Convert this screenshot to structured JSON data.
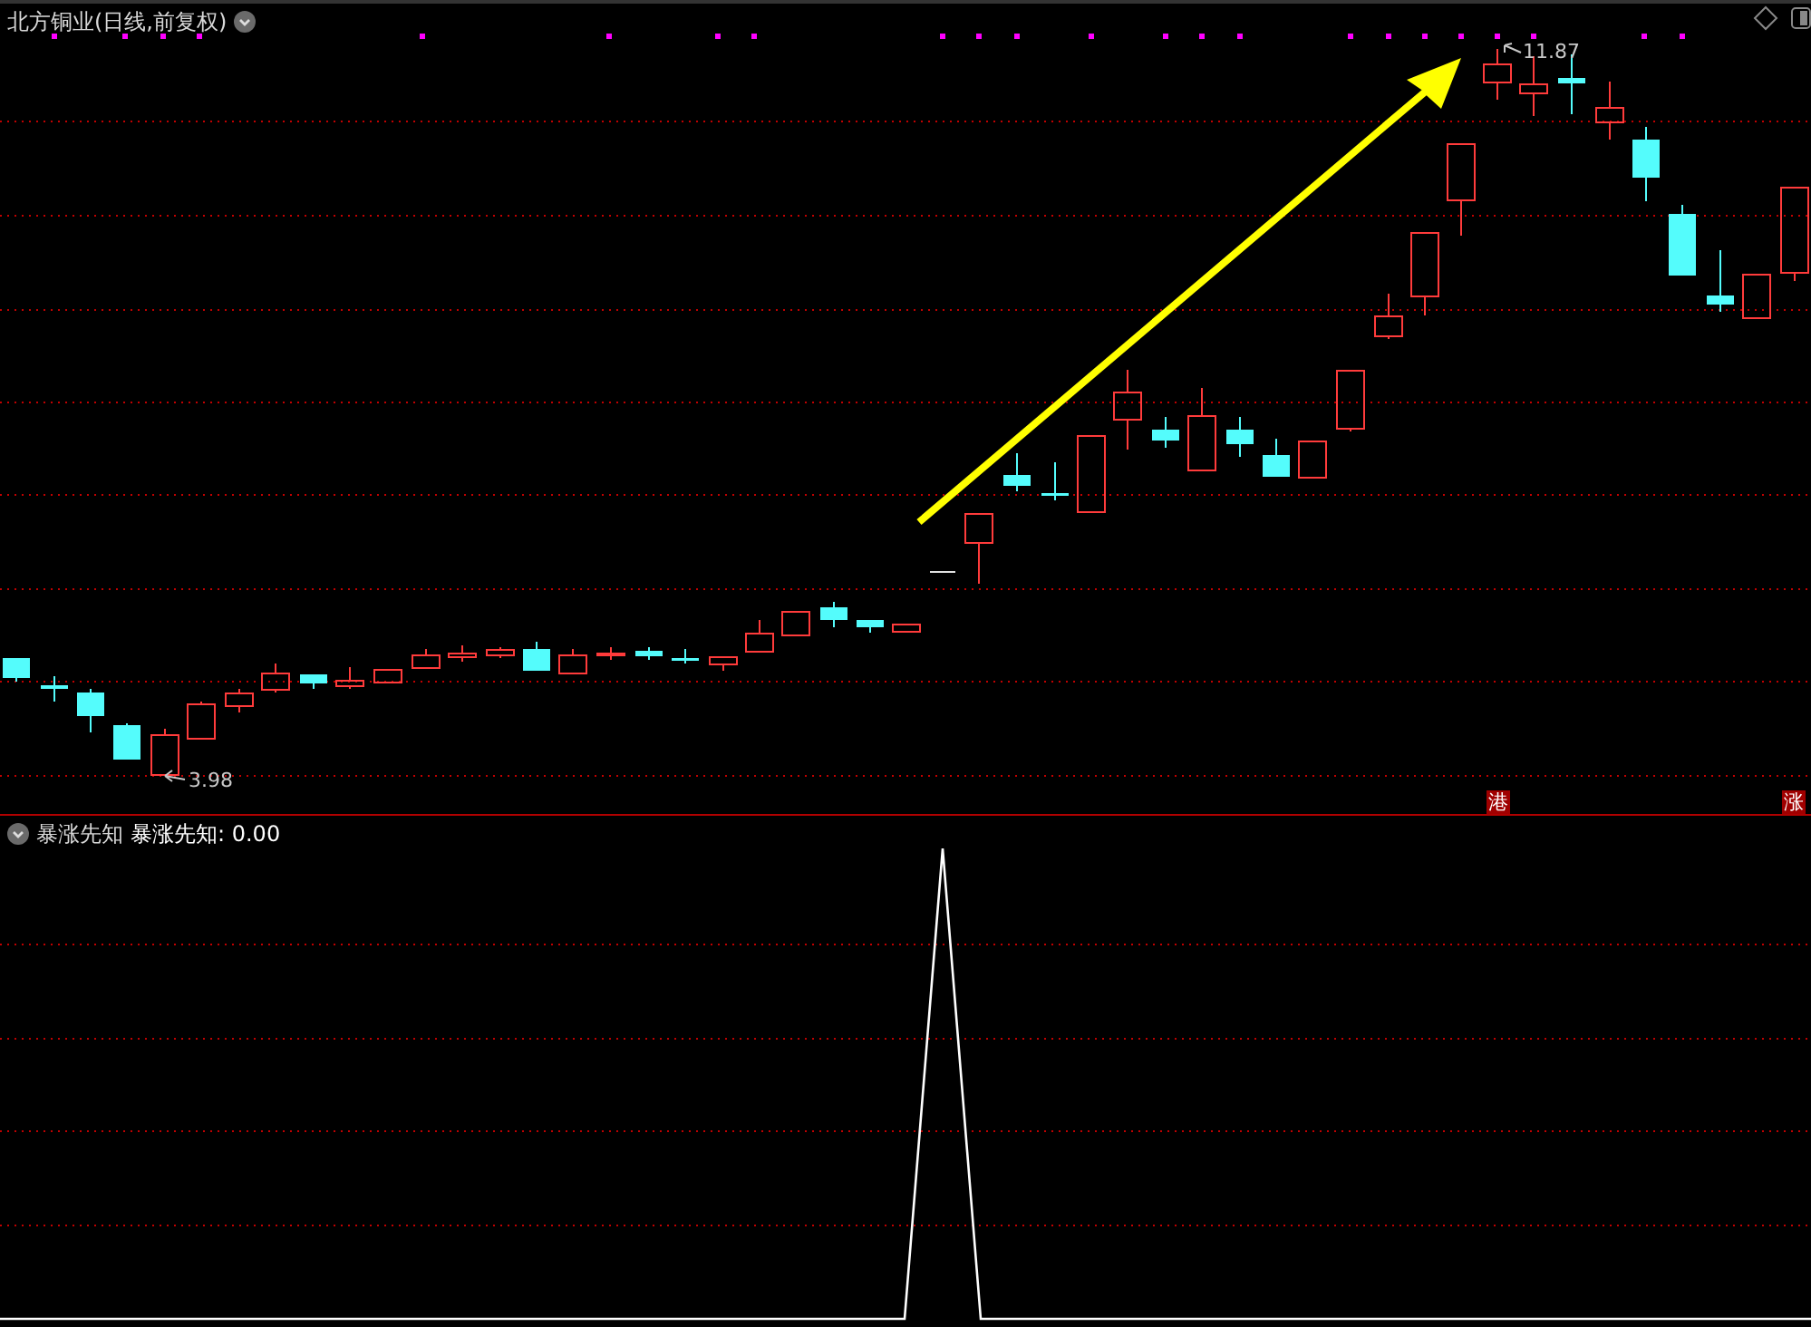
{
  "title": "北方铜业(日线,前复权)",
  "price_panel": {
    "high_label": "11.87",
    "low_label": "3.98",
    "markers": [
      {
        "text": "港"
      },
      {
        "text": "涨"
      }
    ]
  },
  "indicator_panel": {
    "name": "暴涨先知",
    "value_label": "暴涨先知: 0.00"
  }
}
